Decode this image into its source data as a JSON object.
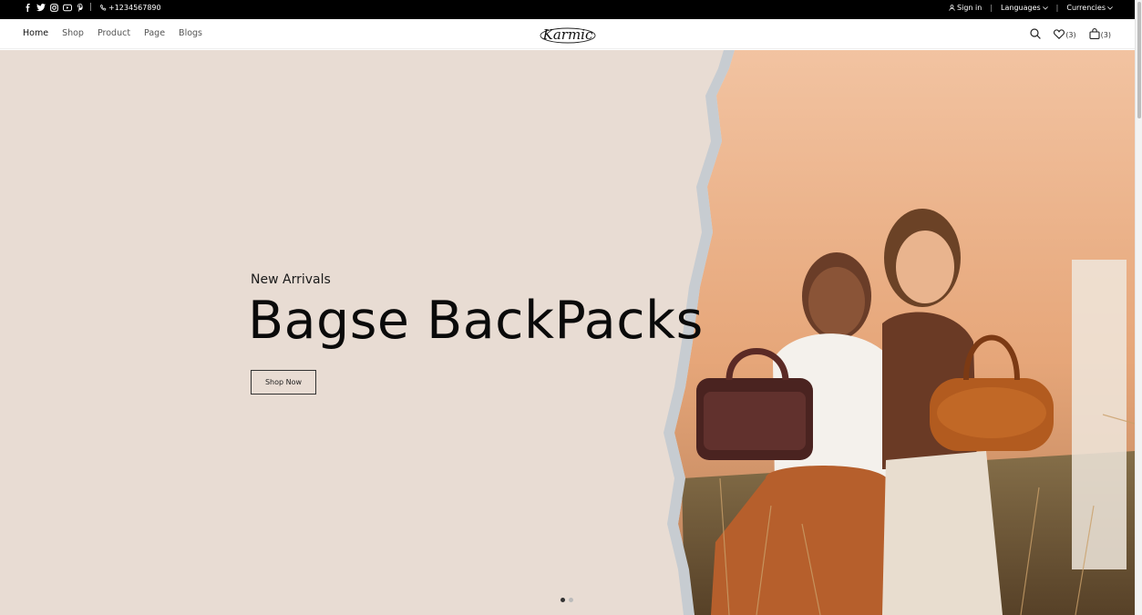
{
  "topbar": {
    "phone": "+1234567890",
    "sign_in": "Sign in",
    "languages": "Languages",
    "currencies": "Currencies",
    "social_icons": [
      "facebook-icon",
      "twitter-icon",
      "instagram-icon",
      "youtube-icon",
      "pinterest-icon"
    ]
  },
  "nav": {
    "items": [
      "Home",
      "Shop",
      "Product",
      "Page",
      "Blogs"
    ],
    "logo": "Karmic",
    "wishlist_count": "(3)",
    "cart_count": "(3)"
  },
  "hero": {
    "subtitle": "New Arrivals",
    "title": "Bagse BackPacks",
    "button": "Shop Now",
    "slides": 2,
    "active_slide": 1
  },
  "colors": {
    "topbar_bg": "#000000",
    "hero_bg": "#e8dcd3",
    "accent_warm": "#e3a57a"
  }
}
